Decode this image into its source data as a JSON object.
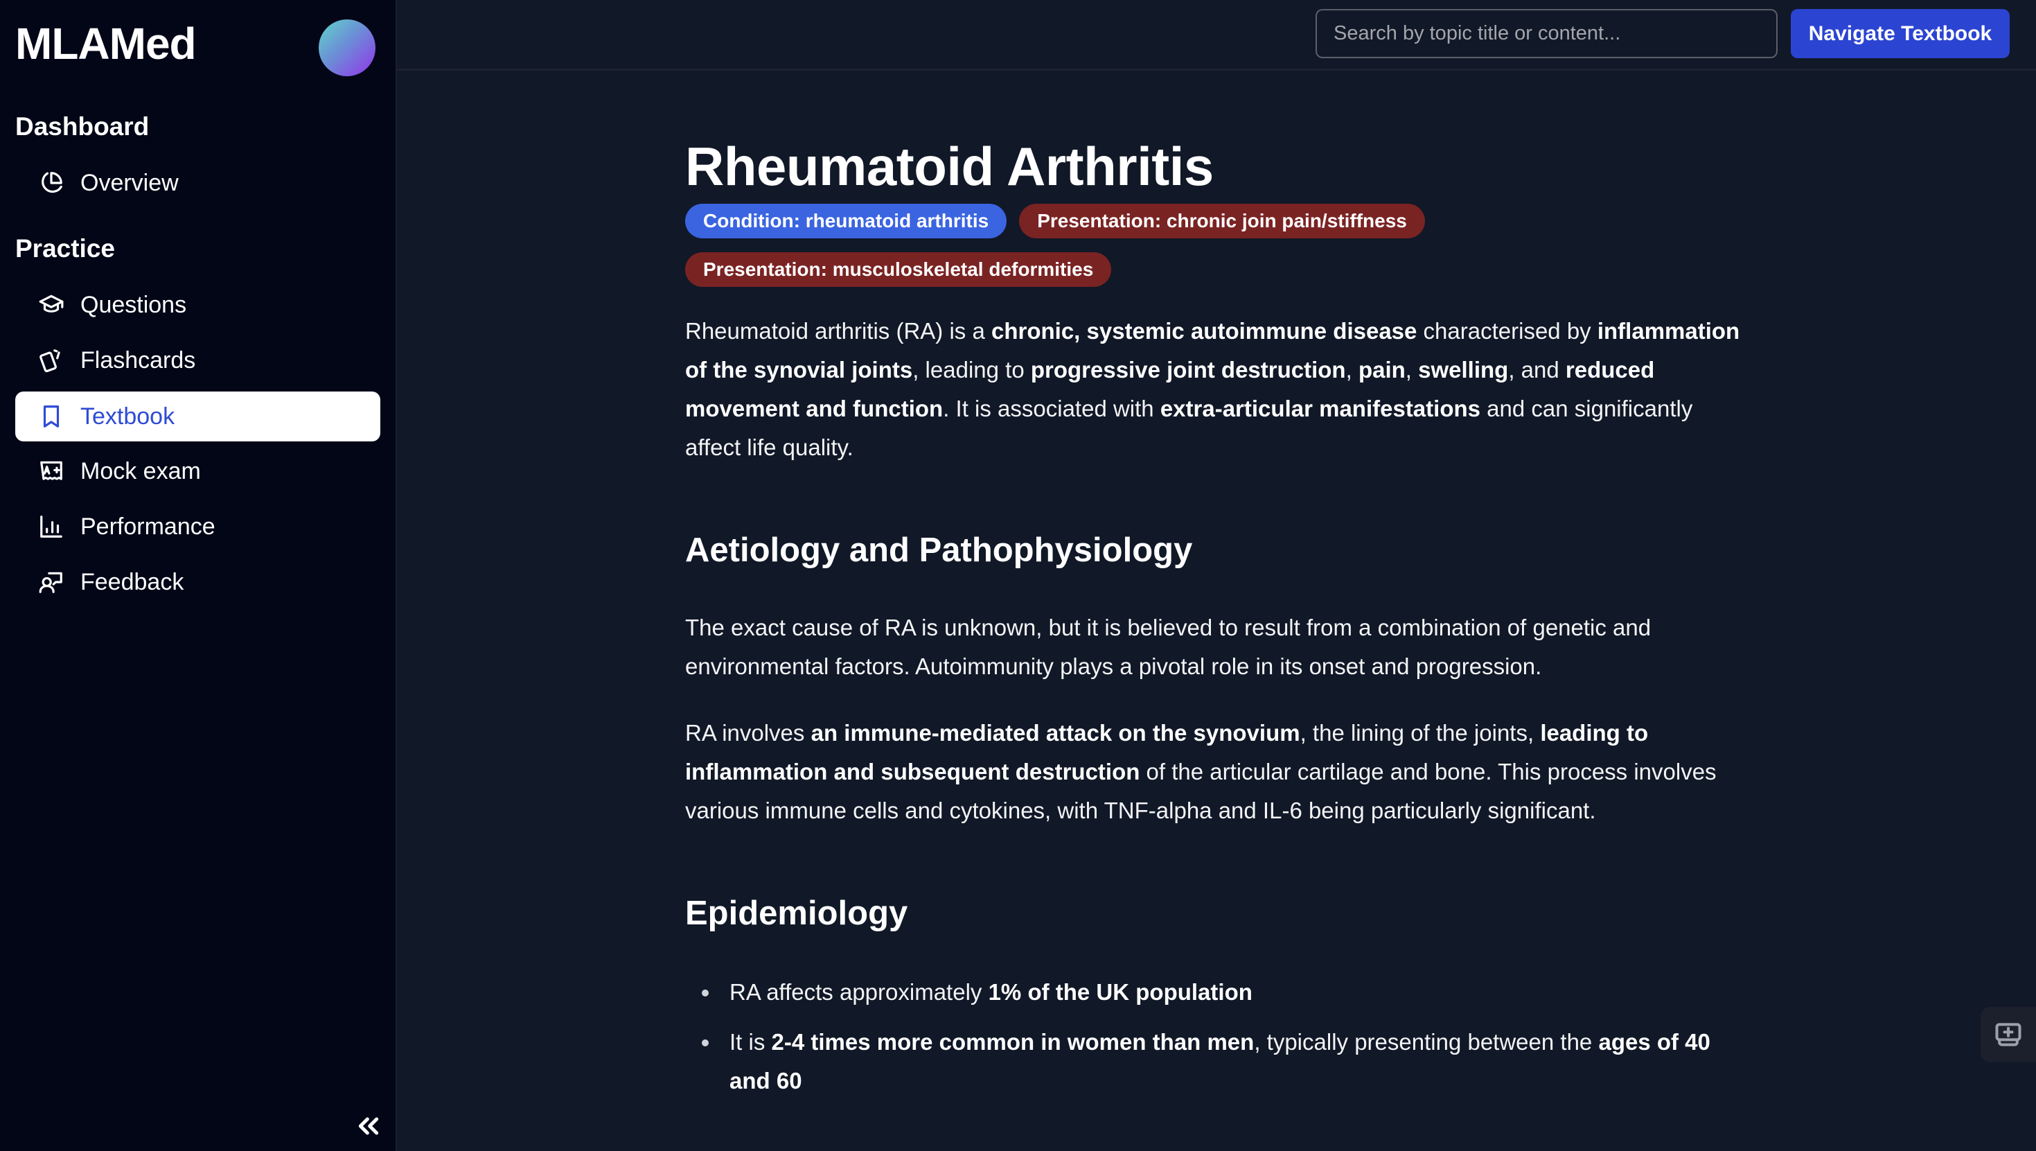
{
  "app": {
    "brand": "MLAMed",
    "accent_color": "#2b44d1"
  },
  "sidebar": {
    "sections": [
      {
        "heading": "Dashboard"
      },
      {
        "heading": "Practice"
      }
    ],
    "items": [
      {
        "label": "Overview",
        "icon": "pie-chart-icon",
        "active": false
      },
      {
        "label": "Questions",
        "icon": "graduation-cap-icon",
        "active": false
      },
      {
        "label": "Flashcards",
        "icon": "cards-icon",
        "active": false
      },
      {
        "label": "Textbook",
        "icon": "bookmark-icon",
        "active": true
      },
      {
        "label": "Mock exam",
        "icon": "exam-grade-icon",
        "active": false
      },
      {
        "label": "Performance",
        "icon": "bar-chart-icon",
        "active": false
      },
      {
        "label": "Feedback",
        "icon": "feedback-icon",
        "active": false
      }
    ],
    "collapse_icon": "double-chevron-left-icon"
  },
  "topbar": {
    "search_placeholder": "Search by topic title or content...",
    "search_value": "",
    "navigate_button": "Navigate Textbook"
  },
  "article": {
    "title": "Rheumatoid Arthritis",
    "tags": [
      {
        "label": "Condition: rheumatoid arthritis",
        "kind": "condition",
        "color": "#3a64e0"
      },
      {
        "label": "Presentation: chronic join pain/stiffness",
        "kind": "presentation",
        "color": "#7a2323"
      },
      {
        "label": "Presentation: musculoskeletal deformities",
        "kind": "presentation",
        "color": "#7a2323"
      }
    ],
    "intro": [
      {
        "t": "Rheumatoid arthritis (RA) is a ",
        "b": false
      },
      {
        "t": "chronic, systemic autoimmune disease",
        "b": true
      },
      {
        "t": " characterised by ",
        "b": false
      },
      {
        "t": "inflammation of the synovial joints",
        "b": true
      },
      {
        "t": ", leading to ",
        "b": false
      },
      {
        "t": "progressive joint destruction",
        "b": true
      },
      {
        "t": ", ",
        "b": false
      },
      {
        "t": "pain",
        "b": true
      },
      {
        "t": ", ",
        "b": false
      },
      {
        "t": "swelling",
        "b": true
      },
      {
        "t": ", and ",
        "b": false
      },
      {
        "t": "reduced movement and function",
        "b": true
      },
      {
        "t": ". It is associated with ",
        "b": false
      },
      {
        "t": "extra-articular manifestations",
        "b": true
      },
      {
        "t": " and can significantly affect life quality.",
        "b": false
      }
    ],
    "sections": [
      {
        "heading": "Aetiology and Pathophysiology",
        "paragraphs": [
          [
            {
              "t": "The exact cause of RA is unknown, but it is believed to result from a combination of genetic and environmental factors. Autoimmunity plays a pivotal role in its onset and progression.",
              "b": false
            }
          ],
          [
            {
              "t": "RA involves ",
              "b": false
            },
            {
              "t": "an immune-mediated attack on the synovium",
              "b": true
            },
            {
              "t": ", the lining of the joints, ",
              "b": false
            },
            {
              "t": "leading to inflammation and subsequent destruction",
              "b": true
            },
            {
              "t": " of the articular cartilage and bone. This process involves various immune cells and cytokines, with TNF-alpha and IL-6 being particularly significant.",
              "b": false
            }
          ]
        ]
      },
      {
        "heading": "Epidemiology",
        "bullets": [
          [
            {
              "t": "RA affects approximately ",
              "b": false
            },
            {
              "t": "1% of the UK population",
              "b": true
            }
          ],
          [
            {
              "t": "It is ",
              "b": false
            },
            {
              "t": "2-4 times more common in women than men",
              "b": true
            },
            {
              "t": ", typically presenting between the ",
              "b": false
            },
            {
              "t": "ages of 40 and 60",
              "b": true
            }
          ]
        ]
      }
    ]
  },
  "floating_action": {
    "icon": "add-to-screen-icon"
  }
}
